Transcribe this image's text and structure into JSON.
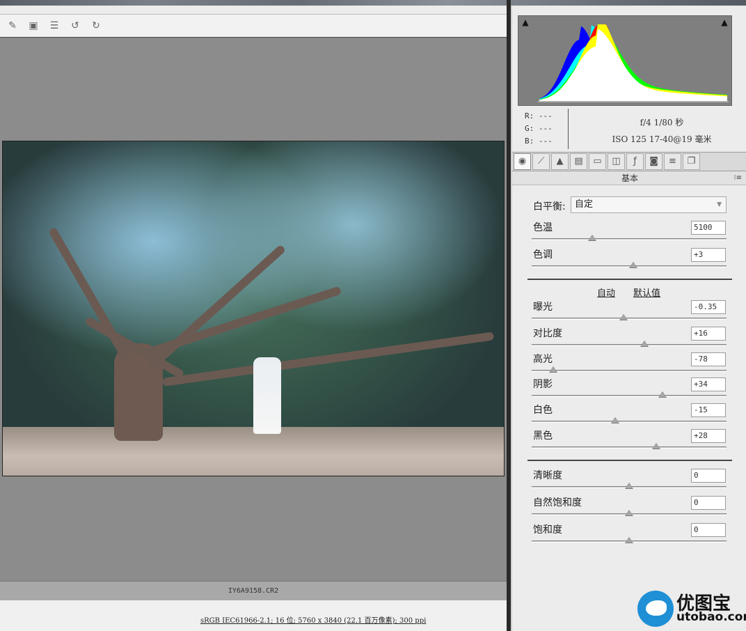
{
  "toolbar": {
    "icons": [
      "brush-icon",
      "erase-icon",
      "list-icon",
      "rotate-left-icon",
      "rotate-right-icon"
    ]
  },
  "viewer": {
    "filename": "IY6A9158.CR2"
  },
  "info": {
    "workflow_link": "sRGB IEC61966-2.1; 16 位; 5760 x 3840 (22.1 百万像素); 300 ppi"
  },
  "histogram": {
    "readout": {
      "r": "R:  ---",
      "g": "G:  ---",
      "b": "B:  ---"
    },
    "exposure": "f/4  1/80 秒",
    "lens": "ISO 125  17-40@19 毫米",
    "colors": {
      "red": "#ff0000",
      "yellow": "#ffff00",
      "green": "#00ff00",
      "cyan": "#00ffff",
      "blue": "#0000ff",
      "white": "#ffffff"
    }
  },
  "panel": {
    "tabs": [
      "basic-icon",
      "tone-curve-icon",
      "detail-icon",
      "hsl-icon",
      "split-toning-icon",
      "lens-correction-icon",
      "effects-icon",
      "camera-calibration-icon",
      "presets-icon",
      "snapshots-icon"
    ],
    "title": "基本",
    "white_balance": {
      "label": "白平衡:",
      "value": "自定"
    },
    "temp": {
      "label": "色温",
      "value": "5100",
      "level": 0.31
    },
    "tint": {
      "label": "色调",
      "value": "+3",
      "level": 0.52
    },
    "auto": "自动",
    "default": "默认值",
    "exposure": {
      "label": "曝光",
      "value": "-0.35",
      "level": 0.47
    },
    "contrast": {
      "label": "对比度",
      "value": "+16",
      "level": 0.58
    },
    "highlights": {
      "label": "高光",
      "value": "-78",
      "level": 0.11
    },
    "shadows": {
      "label": "阴影",
      "value": "+34",
      "level": 0.67
    },
    "whites": {
      "label": "白色",
      "value": "-15",
      "level": 0.43
    },
    "blacks": {
      "label": "黑色",
      "value": "+28",
      "level": 0.64
    },
    "clarity": {
      "label": "清晰度",
      "value": "0",
      "level": 0.5
    },
    "vibrance": {
      "label": "自然饱和度",
      "value": "0",
      "level": 0.5
    },
    "saturation": {
      "label": "饱和度",
      "value": "0",
      "level": 0.5
    }
  },
  "watermark": {
    "cn": "优图宝",
    "url": "utobao.com"
  }
}
